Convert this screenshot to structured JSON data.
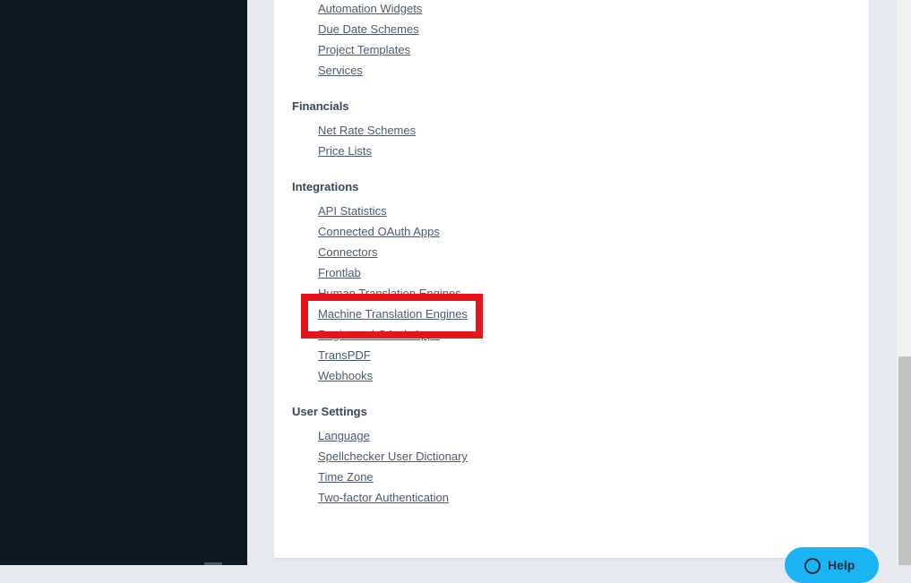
{
  "sections": [
    {
      "title": "",
      "items": [
        "Automation Widgets",
        "Due Date Schemes",
        "Project Templates",
        "Services"
      ]
    },
    {
      "title": "Financials",
      "items": [
        "Net Rate Schemes",
        "Price Lists"
      ]
    },
    {
      "title": "Integrations",
      "items": [
        "API Statistics",
        "Connected OAuth Apps",
        "Connectors",
        "Frontlab",
        "Human Translation Engines",
        "Machine Translation Engines",
        "Registered OAuth Apps",
        "TransPDF",
        "Webhooks"
      ]
    },
    {
      "title": "User Settings",
      "items": [
        "Language",
        "Spellchecker User Dictionary",
        "Time Zone",
        "Two-factor Authentication"
      ]
    }
  ],
  "highlight": {
    "label": "Machine Translation Engines",
    "color": "#e8141c"
  },
  "help": {
    "label": "Help",
    "icon": "help-circle-icon",
    "color": "#1ab4f5"
  }
}
